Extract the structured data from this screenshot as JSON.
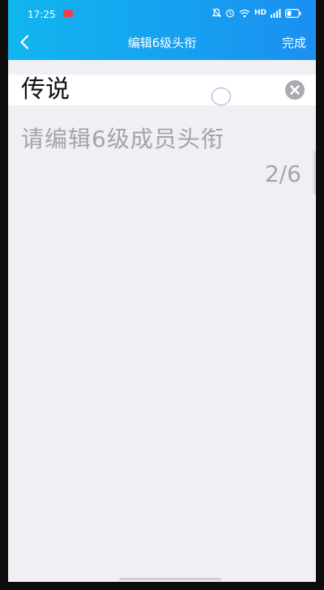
{
  "status_bar": {
    "time": "17:25",
    "network": "HD",
    "icons": [
      "rec-icon",
      "mute-icon",
      "alarm-icon",
      "wifi-icon",
      "signal-icon",
      "battery-icon"
    ]
  },
  "header": {
    "back_icon": "chevron-left-icon",
    "title": "编辑6级头衔",
    "done_label": "完成"
  },
  "editor": {
    "value": "传说",
    "clear_icon": "clear-icon",
    "hint": "请编辑6级成员头衔",
    "counter": "2/6"
  },
  "colors": {
    "header_gradient_start": "#11b6ef",
    "header_gradient_end": "#1a8ff0",
    "background": "#efeff4",
    "hint_text": "#a3a3a8"
  }
}
